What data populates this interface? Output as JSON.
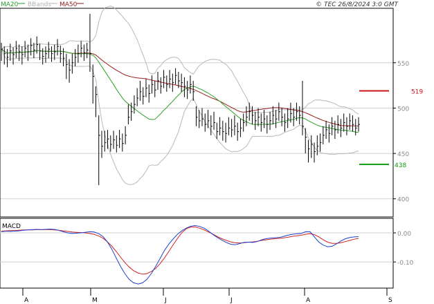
{
  "header": {
    "legend": [
      {
        "label": "MA20",
        "color": "#2a9d2a"
      },
      {
        "label": "BBands",
        "color": "#b0b0b0"
      },
      {
        "label": "MA50",
        "color": "#8b1a1a"
      }
    ],
    "copyright": "© TEC 26/8/2024 3:0 GMT"
  },
  "colors": {
    "price": "#000000",
    "ma20": "#2a9d2a",
    "ma50": "#9b1c1c",
    "bbands": "#b8b8b8",
    "grid": "#d0d0d0",
    "macd_line": "#1a3fd1",
    "signal_line": "#d42222",
    "resistance": "#cc1111",
    "support": "#119911"
  },
  "chart_data": [
    {
      "type": "line",
      "name": "price",
      "y_tick_labels": [
        "550",
        "500",
        "450",
        "400"
      ],
      "ylim": [
        380,
        610
      ],
      "x_tick_labels": [
        "A",
        "M",
        "J",
        "J",
        "A",
        "S"
      ],
      "levels": [
        {
          "label": "519",
          "value": 519,
          "kind": "resistance"
        },
        {
          "label": "438",
          "value": 438,
          "kind": "support"
        }
      ],
      "bars": [
        [
          565,
          572,
          552
        ],
        [
          560,
          568,
          548
        ],
        [
          556,
          565,
          545
        ],
        [
          563,
          571,
          552
        ],
        [
          559,
          567,
          548
        ],
        [
          566,
          574,
          555
        ],
        [
          562,
          570,
          552
        ],
        [
          559,
          568,
          548
        ],
        [
          566,
          574,
          556
        ],
        [
          562,
          570,
          552
        ],
        [
          569,
          577,
          558
        ],
        [
          564,
          572,
          555
        ],
        [
          570,
          579,
          560
        ],
        [
          563,
          571,
          553
        ],
        [
          557,
          566,
          548
        ],
        [
          560,
          568,
          550
        ],
        [
          565,
          573,
          555
        ],
        [
          560,
          568,
          551
        ],
        [
          562,
          570,
          553
        ],
        [
          568,
          576,
          558
        ],
        [
          560,
          569,
          550
        ],
        [
          555,
          566,
          546
        ],
        [
          548,
          560,
          532
        ],
        [
          542,
          554,
          528
        ],
        [
          550,
          560,
          538
        ],
        [
          556,
          565,
          546
        ],
        [
          560,
          570,
          550
        ],
        [
          566,
          574,
          556
        ],
        [
          561,
          570,
          552
        ],
        [
          564,
          572,
          555
        ],
        [
          560,
          604,
          540
        ],
        [
          535,
          548,
          505
        ],
        [
          515,
          524,
          490
        ],
        [
          470,
          492,
          415
        ],
        [
          458,
          475,
          445
        ],
        [
          462,
          475,
          452
        ],
        [
          466,
          476,
          455
        ],
        [
          460,
          470,
          452
        ],
        [
          465,
          475,
          455
        ],
        [
          459,
          470,
          451
        ],
        [
          466,
          476,
          456
        ],
        [
          461,
          472,
          452
        ],
        [
          470,
          480,
          460
        ],
        [
          490,
          504,
          482
        ],
        [
          496,
          506,
          486
        ],
        [
          504,
          514,
          494
        ],
        [
          511,
          522,
          502
        ],
        [
          518,
          530,
          508
        ],
        [
          513,
          523,
          504
        ],
        [
          522,
          532,
          512
        ],
        [
          516,
          526,
          506
        ],
        [
          526,
          536,
          516
        ],
        [
          520,
          530,
          512
        ],
        [
          530,
          540,
          520
        ],
        [
          524,
          534,
          516
        ],
        [
          534,
          542,
          522
        ],
        [
          526,
          536,
          518
        ],
        [
          532,
          542,
          522
        ],
        [
          528,
          538,
          518
        ],
        [
          536,
          544,
          526
        ],
        [
          530,
          540,
          522
        ],
        [
          528,
          538,
          518
        ],
        [
          524,
          534,
          512
        ],
        [
          520,
          530,
          510
        ],
        [
          526,
          536,
          516
        ],
        [
          518,
          530,
          508
        ],
        [
          490,
          502,
          480
        ],
        [
          486,
          498,
          478
        ],
        [
          488,
          500,
          480
        ],
        [
          482,
          494,
          474
        ],
        [
          486,
          498,
          478
        ],
        [
          480,
          492,
          470
        ],
        [
          484,
          496,
          476
        ],
        [
          474,
          484,
          466
        ],
        [
          478,
          490,
          470
        ],
        [
          474,
          486,
          464
        ],
        [
          472,
          484,
          462
        ],
        [
          478,
          490,
          470
        ],
        [
          476,
          488,
          468
        ],
        [
          480,
          492,
          470
        ],
        [
          474,
          484,
          464
        ],
        [
          478,
          488,
          468
        ],
        [
          484,
          494,
          474
        ],
        [
          490,
          502,
          480
        ],
        [
          496,
          506,
          486
        ],
        [
          492,
          502,
          482
        ],
        [
          486,
          496,
          476
        ],
        [
          490,
          500,
          480
        ],
        [
          484,
          494,
          474
        ],
        [
          488,
          498,
          478
        ],
        [
          482,
          492,
          472
        ],
        [
          486,
          496,
          476
        ],
        [
          492,
          502,
          482
        ],
        [
          488,
          498,
          478
        ],
        [
          496,
          506,
          486
        ],
        [
          490,
          500,
          480
        ],
        [
          484,
          494,
          474
        ],
        [
          488,
          500,
          478
        ],
        [
          494,
          506,
          484
        ],
        [
          490,
          500,
          480
        ],
        [
          496,
          506,
          486
        ],
        [
          492,
          502,
          482
        ],
        [
          480,
          530,
          470
        ],
        [
          468,
          478,
          450
        ],
        [
          455,
          465,
          440
        ],
        [
          460,
          470,
          445
        ],
        [
          452,
          462,
          440
        ],
        [
          458,
          470,
          448
        ],
        [
          462,
          472,
          452
        ],
        [
          470,
          480,
          460
        ],
        [
          476,
          486,
          466
        ],
        [
          472,
          482,
          462
        ],
        [
          480,
          490,
          470
        ],
        [
          476,
          486,
          466
        ],
        [
          482,
          492,
          472
        ],
        [
          478,
          488,
          468
        ],
        [
          484,
          494,
          474
        ],
        [
          480,
          490,
          470
        ],
        [
          486,
          494,
          476
        ],
        [
          482,
          492,
          474
        ],
        [
          478,
          488,
          470
        ],
        [
          482,
          490,
          474
        ]
      ]
    },
    {
      "type": "line",
      "name": "MACD",
      "title": "MACD",
      "y_tick_labels": [
        "0.00",
        "-0.10"
      ],
      "ylim": [
        -0.19,
        0.05
      ],
      "macd": [
        0.004,
        0.006,
        0.005,
        0.006,
        0.007,
        0.009,
        0.01,
        0.011,
        0.012,
        0.011,
        0.012,
        0.013,
        0.012,
        0.009,
        0.004,
        0,
        -0.002,
        -0.001,
        0,
        0.002,
        0.004,
        0.003,
        -0.002,
        -0.012,
        -0.03,
        -0.055,
        -0.085,
        -0.115,
        -0.14,
        -0.16,
        -0.172,
        -0.176,
        -0.172,
        -0.16,
        -0.14,
        -0.115,
        -0.088,
        -0.06,
        -0.038,
        -0.02,
        -0.004,
        0.008,
        0.017,
        0.023,
        0.025,
        0.022,
        0.016,
        0.006,
        -0.006,
        -0.016,
        -0.025,
        -0.033,
        -0.039,
        -0.041,
        -0.037,
        -0.033,
        -0.032,
        -0.033,
        -0.03,
        -0.024,
        -0.02,
        -0.018,
        -0.017,
        -0.016,
        -0.012,
        -0.008,
        -0.005,
        -0.003,
        -0.002,
        0.004,
        0.004,
        -0.014,
        -0.032,
        -0.042,
        -0.048,
        -0.046,
        -0.038,
        -0.028,
        -0.02,
        -0.016,
        -0.014,
        -0.013
      ],
      "signal": [
        0.006,
        0.007,
        0.008,
        0.008,
        0.009,
        0.01,
        0.01,
        0.01,
        0.011,
        0.011,
        0.011,
        0.011,
        0.01,
        0.009,
        0.007,
        0.005,
        0.003,
        0.002,
        0.001,
        0,
        -0.002,
        -0.005,
        -0.01,
        -0.018,
        -0.03,
        -0.045,
        -0.063,
        -0.083,
        -0.102,
        -0.118,
        -0.13,
        -0.138,
        -0.142,
        -0.14,
        -0.133,
        -0.122,
        -0.106,
        -0.086,
        -0.063,
        -0.04,
        -0.018,
        0.002,
        0.015,
        0.02,
        0.02,
        0.016,
        0.01,
        0.003,
        -0.005,
        -0.013,
        -0.02,
        -0.026,
        -0.031,
        -0.034,
        -0.035,
        -0.034,
        -0.032,
        -0.031,
        -0.029,
        -0.026,
        -0.024,
        -0.022,
        -0.02,
        -0.019,
        -0.017,
        -0.015,
        -0.012,
        -0.01,
        -0.008,
        -0.005,
        -0.003,
        -0.006,
        -0.014,
        -0.024,
        -0.032,
        -0.036,
        -0.036,
        -0.034,
        -0.03,
        -0.026,
        -0.022,
        -0.019
      ]
    }
  ]
}
